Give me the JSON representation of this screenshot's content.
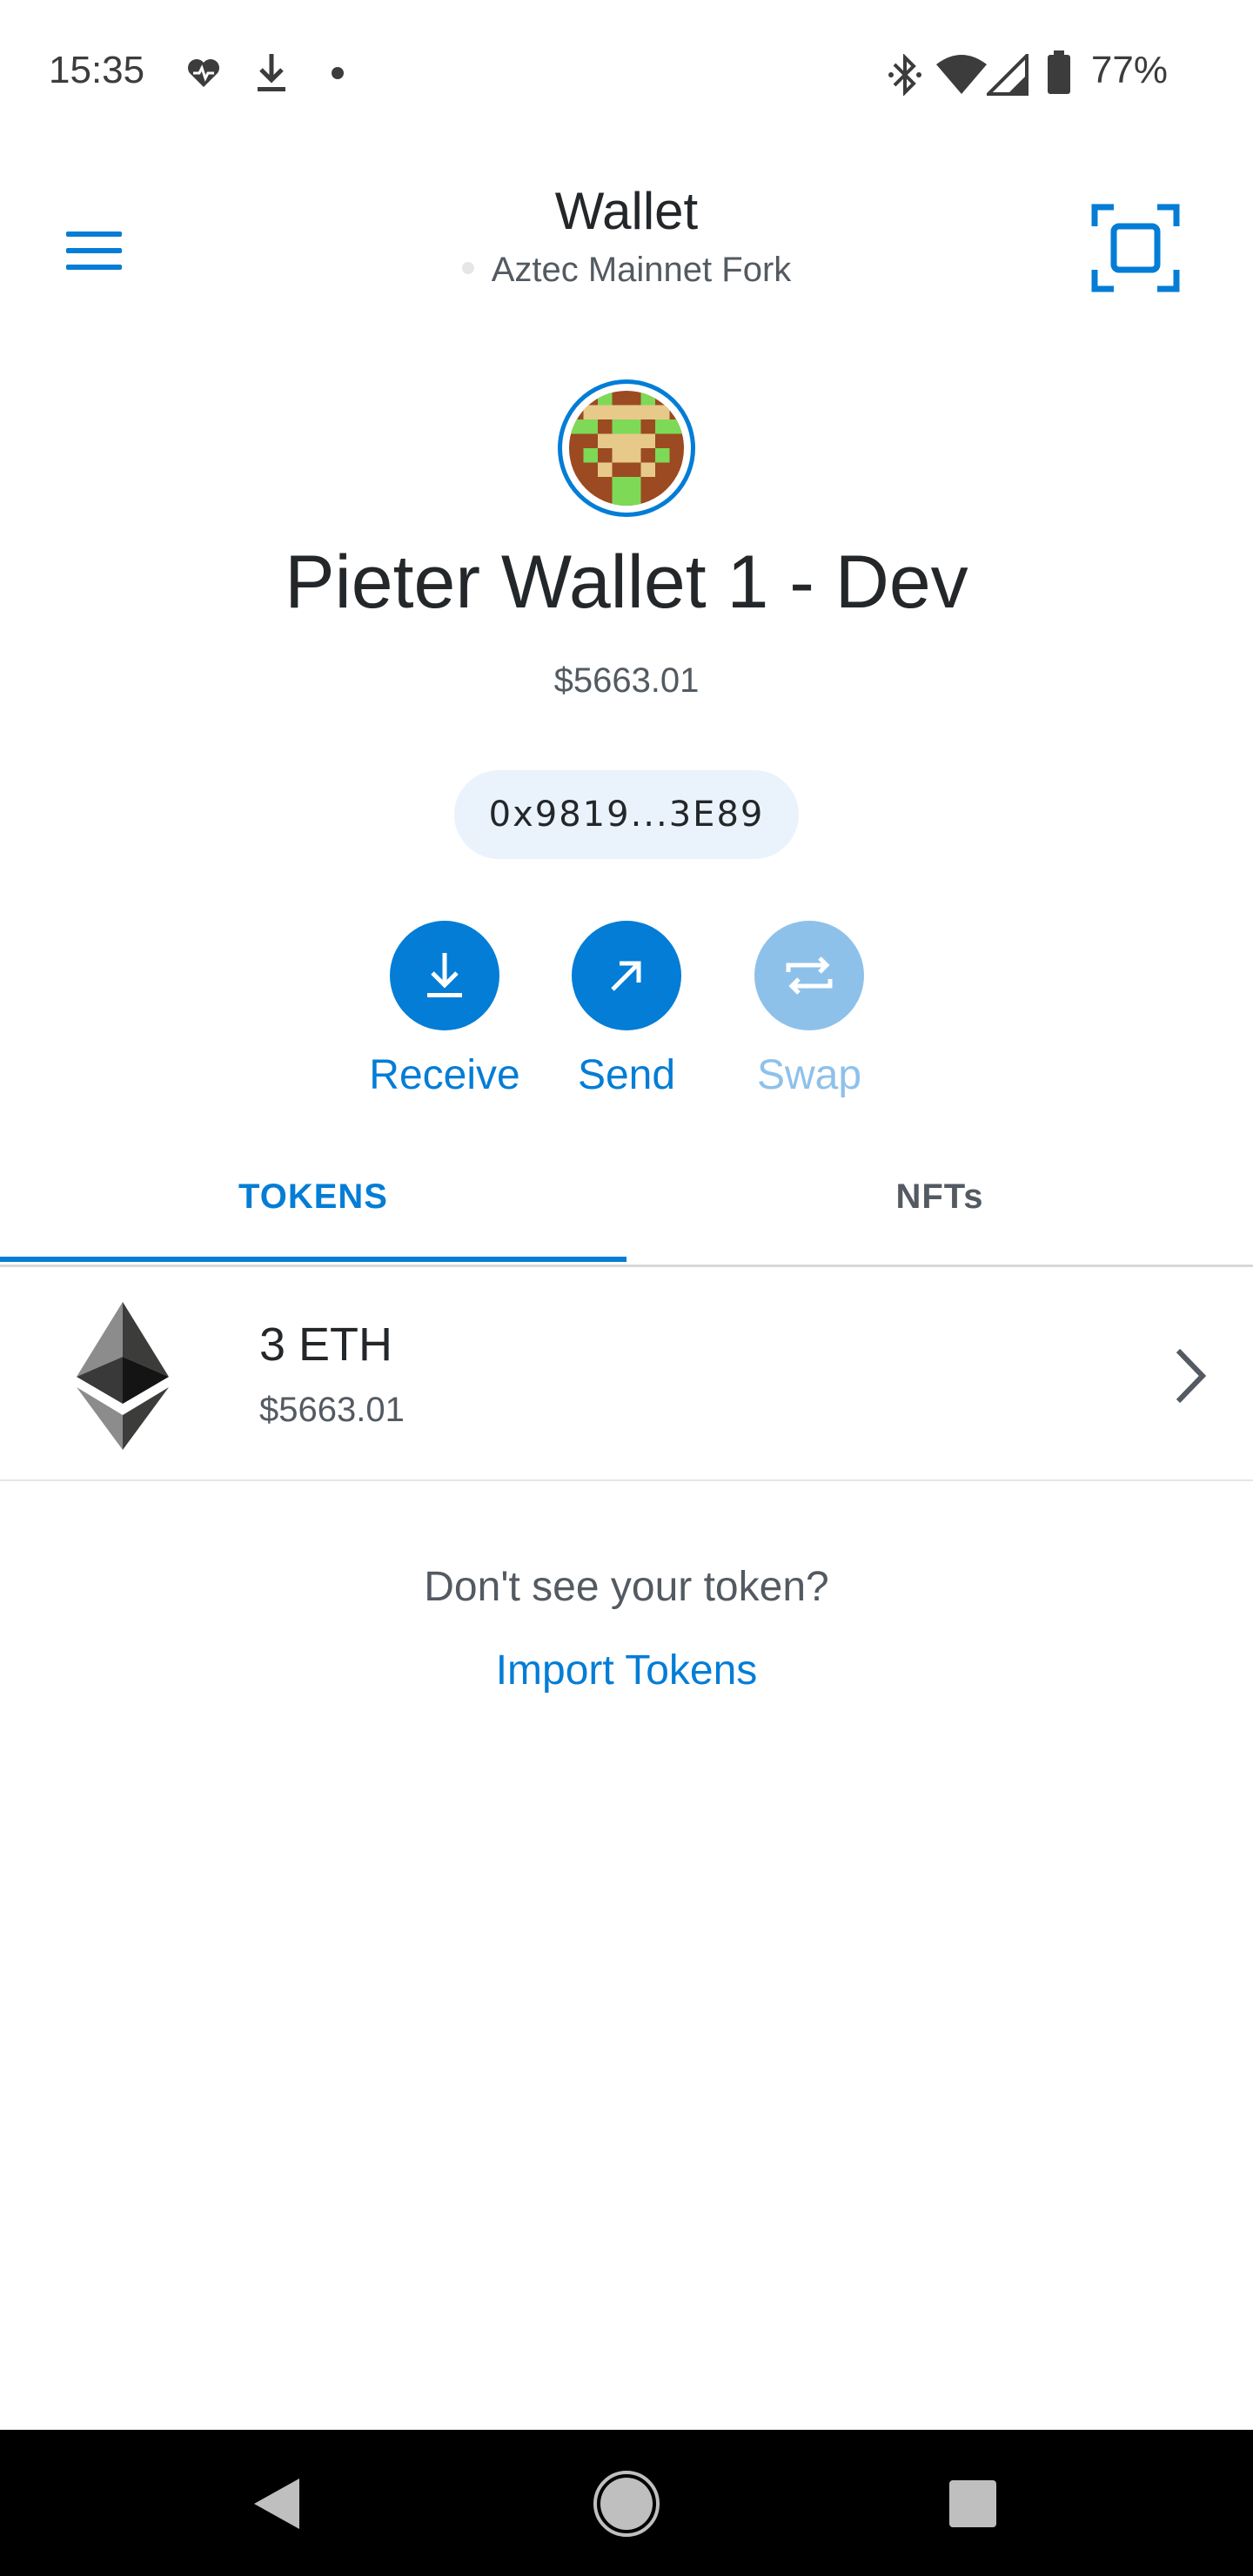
{
  "status_bar": {
    "time": "15:35",
    "battery": "77%",
    "left_icons": [
      "heart-pulse-icon",
      "download-icon",
      "dot-icon"
    ],
    "right_icons": [
      "bluetooth-icon",
      "wifi-icon",
      "signal-icon",
      "battery-icon"
    ]
  },
  "header": {
    "title": "Wallet",
    "network": "Aztec Mainnet Fork",
    "menu_icon": "hamburger-menu-icon",
    "scan_icon": "qr-scan-icon"
  },
  "account": {
    "name": "Pieter Wallet 1 - Dev",
    "balance": "$5663.01",
    "address": "0x9819...3E89"
  },
  "actions": [
    {
      "label": "Receive",
      "icon": "download-arrow-icon",
      "enabled": true
    },
    {
      "label": "Send",
      "icon": "arrow-up-right-icon",
      "enabled": true
    },
    {
      "label": "Swap",
      "icon": "swap-icon",
      "enabled": false
    }
  ],
  "tabs": [
    {
      "label": "TOKENS",
      "active": true
    },
    {
      "label": "NFTs",
      "active": false
    }
  ],
  "tokens": [
    {
      "amount": "3 ETH",
      "fiat": "$5663.01",
      "icon": "ethereum-icon"
    }
  ],
  "import": {
    "prompt": "Don't see your token?",
    "link": "Import Tokens"
  },
  "colors": {
    "primary": "#037dd6",
    "disabled": "#8ec1ea",
    "text": "#24272a",
    "muted": "#535a61",
    "address_bg": "#eaf3fc"
  }
}
